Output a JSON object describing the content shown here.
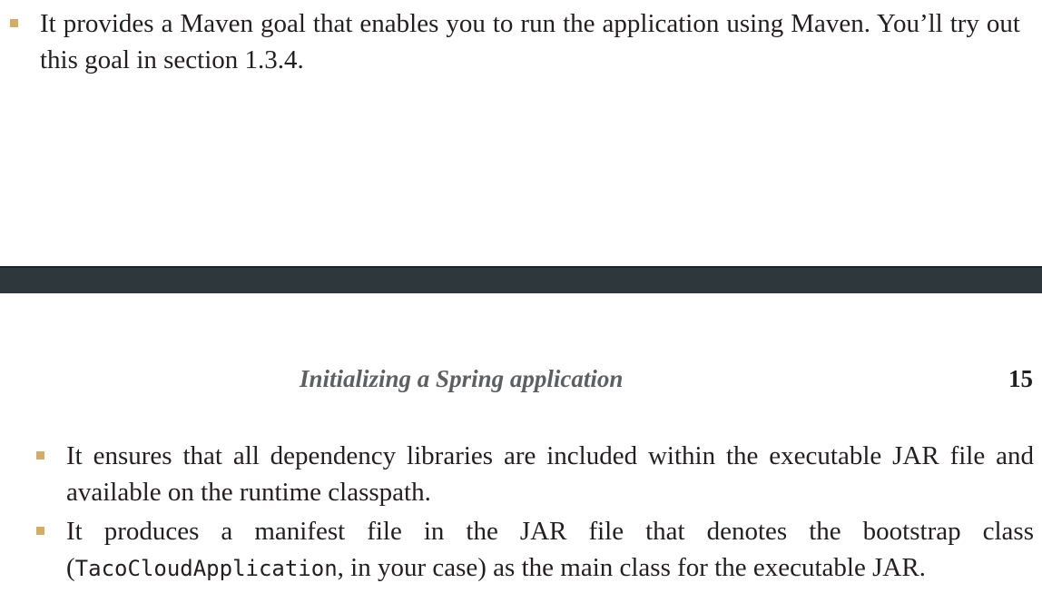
{
  "top_page": {
    "bullet": {
      "text": "It provides a Maven goal that enables you to run the application using Maven. You’ll try out this goal in section 1.3.4."
    }
  },
  "bottom_page": {
    "running_head": "Initializing a Spring application",
    "page_number": "15",
    "bullets": [
      {
        "text": "It ensures that all dependency libraries are included within the executable JAR file and available on the runtime classpath."
      },
      {
        "prefix": "It produces a manifest file in the JAR file that denotes the bootstrap class (",
        "code": "TacoCloudApplication",
        "suffix": ", in your case) as the main class for the executable JAR."
      }
    ]
  },
  "colors": {
    "bullet_marker": "#d2ac68",
    "divider": "#2e373b",
    "running_head": "#5d5f61"
  }
}
